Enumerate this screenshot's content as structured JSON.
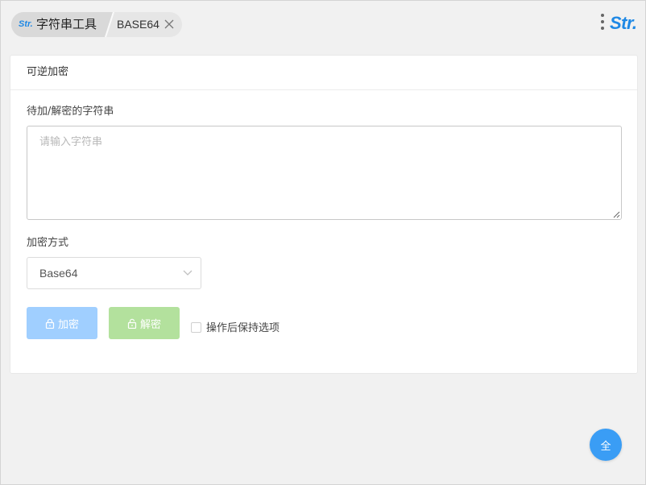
{
  "header": {
    "logo_small": "Str.",
    "app_title": "字符串工具",
    "tab_label": "BASE64",
    "logo_big": "Str."
  },
  "card": {
    "title": "可逆加密",
    "input_label": "待加/解密的字符串",
    "input_placeholder": "请输入字符串",
    "input_value": "",
    "method_label": "加密方式",
    "method_selected": "Base64",
    "encrypt_label": "加密",
    "decrypt_label": "解密",
    "keep_options_label": "操作后保持选项",
    "keep_options_checked": false
  },
  "fab": {
    "label": "全"
  },
  "colors": {
    "accent": "#1e88e5",
    "encrypt_button": "#a0cfff",
    "decrypt_button": "#b3e19d",
    "fab": "#3a9df5"
  },
  "icons": {
    "close": "close-icon",
    "menu": "more-vertical-icon",
    "select_arrow": "chevron-down-icon",
    "encrypt": "lock-icon",
    "decrypt": "unlock-icon"
  }
}
